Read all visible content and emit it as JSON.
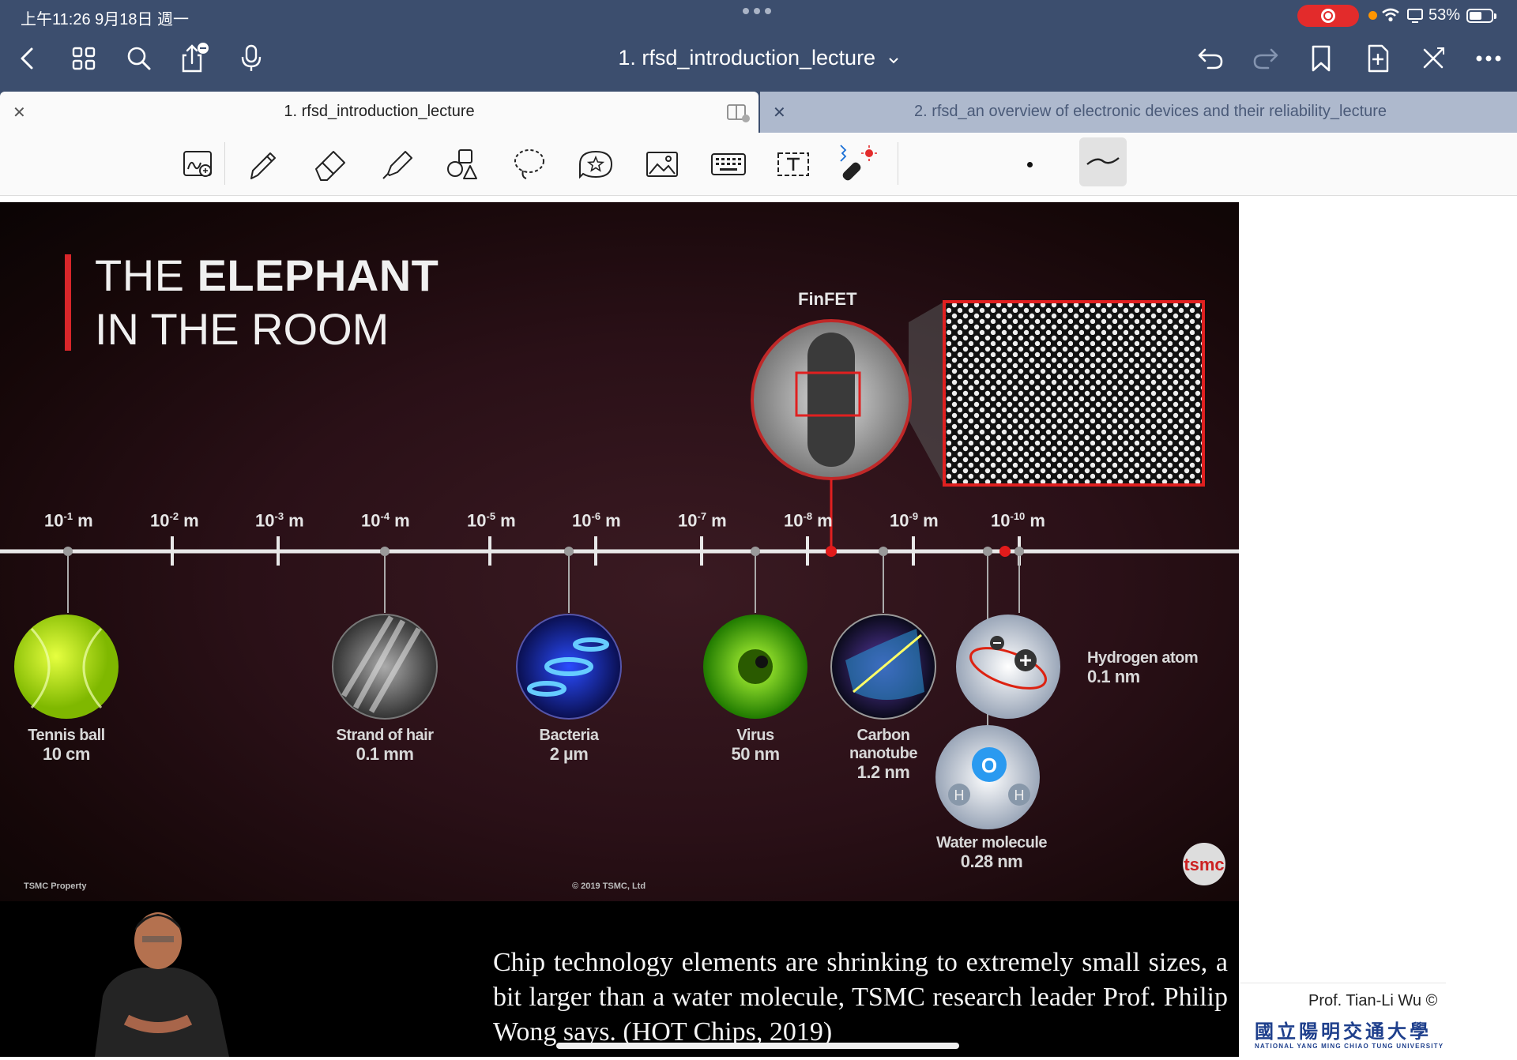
{
  "status": {
    "time": "上午11:26 9月18日 週一",
    "battery": "53%"
  },
  "toolbar": {
    "document_title": "1. rfsd_introduction_lecture"
  },
  "tabs": [
    {
      "label": "1. rfsd_introduction_lecture",
      "active": true
    },
    {
      "label": "2. rfsd_an overview of electronic devices and their reliability_lecture",
      "active": false
    }
  ],
  "slide": {
    "title_line1_plain": "THE ",
    "title_line1_bold": "ELEPHANT",
    "title_line2": "IN THE ROOM",
    "finfet_label": "FinFET",
    "scale": [
      {
        "base": "10",
        "exp": "-1",
        "unit": "m"
      },
      {
        "base": "10",
        "exp": "-2",
        "unit": "m"
      },
      {
        "base": "10",
        "exp": "-3",
        "unit": "m"
      },
      {
        "base": "10",
        "exp": "-4",
        "unit": "m"
      },
      {
        "base": "10",
        "exp": "-5",
        "unit": "m"
      },
      {
        "base": "10",
        "exp": "-6",
        "unit": "m"
      },
      {
        "base": "10",
        "exp": "-7",
        "unit": "m"
      },
      {
        "base": "10",
        "exp": "-8",
        "unit": "m"
      },
      {
        "base": "10",
        "exp": "-9",
        "unit": "m"
      },
      {
        "base": "10",
        "exp": "-10",
        "unit": "m"
      }
    ],
    "objects": [
      {
        "name": "Tennis ball",
        "size": "10 cm"
      },
      {
        "name": "Strand of hair",
        "size": "0.1 mm"
      },
      {
        "name": "Bacteria",
        "size": "2 µm"
      },
      {
        "name": "Virus",
        "size": "50 nm"
      },
      {
        "name": "Carbon nanotube",
        "name1": "Carbon",
        "name2": "nanotube",
        "size": "1.2 nm"
      },
      {
        "name": "Hydrogen atom",
        "size": "0.1 nm"
      },
      {
        "name": "Water molecule",
        "size": "0.28 nm"
      }
    ],
    "footer_left": "TSMC Property",
    "footer_center": "© 2019 TSMC, Ltd",
    "logo": "tsmc",
    "caption": "Chip technology elements are shrinking to extremely small sizes, a bit larger than a water molecule, TSMC research leader Prof. Philip Wong says. (HOT Chips, 2019)"
  },
  "side_panel": {
    "credit": "Prof. Tian-Li Wu ©",
    "university_zh": "國立陽明交通大學",
    "university_en": "NATIONAL YANG MING CHIAO TUNG UNIVERSITY"
  },
  "colors": {
    "header": "#3c4e6e",
    "tab_inactive": "#aeb9cd",
    "accent_red": "#d8262a",
    "record": "#e32b2b"
  },
  "icons": [
    "back-icon",
    "grid-icon",
    "search-icon",
    "share-icon",
    "microphone-icon",
    "undo-icon",
    "redo-icon",
    "bookmark-icon",
    "add-page-icon",
    "close-toolbar-icon",
    "more-icon"
  ]
}
